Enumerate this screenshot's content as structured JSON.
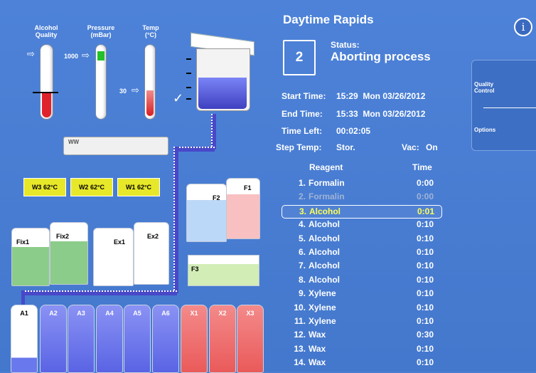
{
  "gauges": {
    "alcohol": {
      "label_line1": "Alcohol",
      "label_line2": "Quality"
    },
    "pressure": {
      "label_line1": "Pressure",
      "label_line2": "(mBar)",
      "value_label": "1000"
    },
    "temp": {
      "label_line1": "Temp",
      "label_line2": "(°C)",
      "value_label": "30"
    }
  },
  "protocol": {
    "title": "Daytime Rapids",
    "step_number": "2",
    "status_label": "Status:",
    "status_value": "Aborting process",
    "start_label": "Start Time:",
    "start_value": "15:29  Mon 03/26/2012",
    "end_label": "End Time:",
    "end_value": "15:33  Mon 03/26/2012",
    "left_label": "Time Left:",
    "left_value": "00:02:05",
    "steptemp_label": "Step Temp:",
    "steptemp_value": "Stor.",
    "vac_label": "Vac:",
    "vac_value": "On",
    "col_reagent": "Reagent",
    "col_time": "Time",
    "steps": [
      {
        "n": "1.",
        "name": "Formalin",
        "time": "0:00"
      },
      {
        "n": "2.",
        "name": "Formalin",
        "time": "0:00"
      },
      {
        "n": "3.",
        "name": "Alcohol",
        "time": "0:01"
      },
      {
        "n": "4.",
        "name": "Alcohol",
        "time": "0:10"
      },
      {
        "n": "5.",
        "name": "Alcohol",
        "time": "0:10"
      },
      {
        "n": "6.",
        "name": "Alcohol",
        "time": "0:10"
      },
      {
        "n": "7.",
        "name": "Alcohol",
        "time": "0:10"
      },
      {
        "n": "8.",
        "name": "Alcohol",
        "time": "0:10"
      },
      {
        "n": "9.",
        "name": "Xylene",
        "time": "0:10"
      },
      {
        "n": "10.",
        "name": "Xylene",
        "time": "0:10"
      },
      {
        "n": "11.",
        "name": "Xylene",
        "time": "0:10"
      },
      {
        "n": "12.",
        "name": "Wax",
        "time": "0:30"
      },
      {
        "n": "13.",
        "name": "Wax",
        "time": "0:10"
      },
      {
        "n": "14.",
        "name": "Wax",
        "time": "0:10"
      }
    ]
  },
  "side": {
    "quality_line1": "Quality",
    "quality_line2": "Control",
    "options": "Options",
    "info_icon": "i"
  },
  "tray_label": "WW",
  "baths": [
    {
      "label": "W3   62°C"
    },
    {
      "label": "W2   62°C"
    },
    {
      "label": "W1   62°C"
    }
  ],
  "formalin": {
    "f1": "F1",
    "f2": "F2",
    "f3": "F3"
  },
  "containers": {
    "fix1": "Fix1",
    "fix2": "Fix2",
    "ex1": "Ex1",
    "ex2": "Ex2"
  },
  "jars": [
    "A1",
    "A2",
    "A3",
    "A4",
    "A5",
    "A6",
    "X1",
    "X2",
    "X3"
  ],
  "colors": {
    "background": "#4a7fd4",
    "alcohol": "#6a78ee",
    "xylene": "#f06e6e",
    "fixative": "#8ccc8a",
    "bath": "#e8e82a",
    "highlight": "#ffff55"
  }
}
